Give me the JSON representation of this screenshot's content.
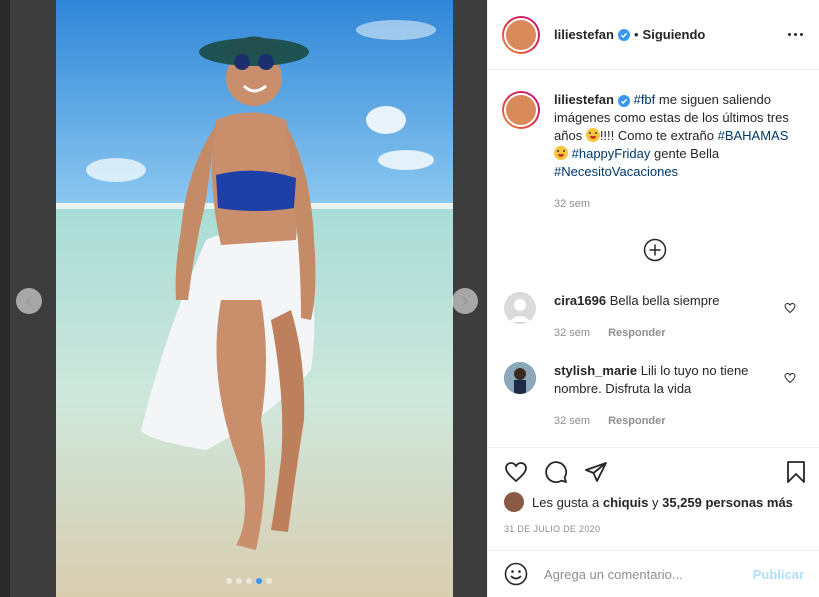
{
  "post": {
    "username": "liliestefan",
    "follow_state": "Siguiendo",
    "separator": "•",
    "caption": {
      "username": "liliestefan",
      "t1": "me siguen saliendo imágenes como estas de los últimos tres años ",
      "t2": "!!!! Como te extraño ",
      "t3": " gente Bella ",
      "tags": [
        "#fbf",
        "#BAHAMAS",
        "#happyFriday",
        "#NecesitoVacaciones"
      ],
      "time": "32 sem"
    }
  },
  "comments": [
    {
      "username": "cira1696",
      "text": "Bella bella siempre",
      "time": "32 sem",
      "reply": "Responder"
    },
    {
      "username": "stylish_marie",
      "text": "Lili lo tuyo no tiene nombre. Disfruta la vida",
      "time": "32 sem",
      "reply": "Responder"
    }
  ],
  "likes": {
    "prefix": "Les gusta a",
    "user": "chiquis",
    "conj": "y",
    "count": "35,259 personas más"
  },
  "date": "31 DE JULIO DE 2020",
  "composer": {
    "placeholder": "Agrega un comentario...",
    "post_label": "Publicar"
  },
  "icons": [
    "verified-icon",
    "more-icon",
    "add-circle-icon",
    "heart-icon",
    "comment-icon",
    "share-icon",
    "bookmark-icon",
    "smile-icon",
    "chevron-left-icon",
    "chevron-right-icon"
  ],
  "colors": {
    "verified": "#3897f0",
    "hashtag": "#00376b",
    "publish_disabled": "#b2dffc",
    "meta": "#8e8e8e"
  },
  "carousel": {
    "slides": 5,
    "active_index": 3
  }
}
